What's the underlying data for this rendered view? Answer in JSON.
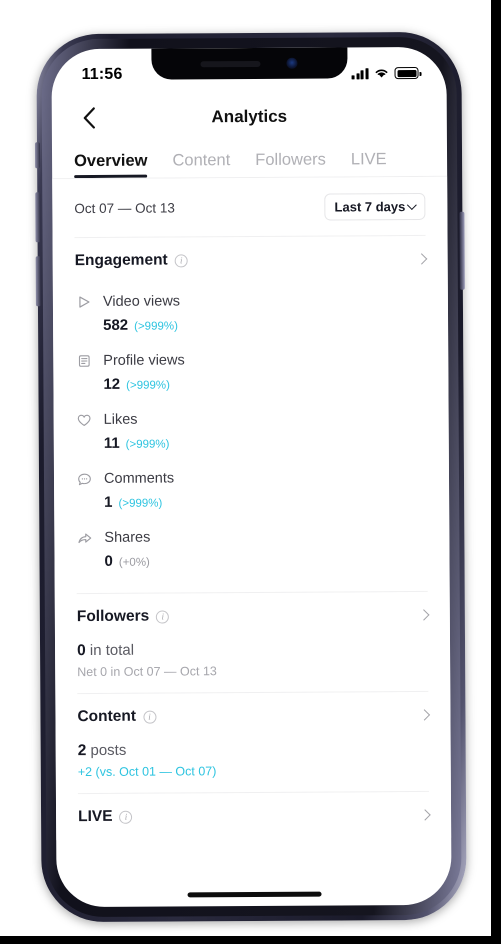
{
  "statusbar": {
    "time": "11:56",
    "signal_icon": "cellular-bars-icon",
    "wifi_icon": "wifi-icon",
    "battery_icon": "battery-icon"
  },
  "navbar": {
    "back_icon": "chevron-left-icon",
    "title": "Analytics"
  },
  "tabs": [
    {
      "label": "Overview",
      "active": true
    },
    {
      "label": "Content",
      "active": false
    },
    {
      "label": "Followers",
      "active": false
    },
    {
      "label": "LIVE",
      "active": false
    }
  ],
  "daterow": {
    "range_text": "Oct 07 — Oct 13",
    "picker_label": "Last 7 days",
    "picker_icon": "chevron-down-icon"
  },
  "engagement": {
    "title": "Engagement",
    "info_icon": "info-icon",
    "chevron_icon": "chevron-right-icon",
    "metrics": [
      {
        "icon": "play-icon",
        "label": "Video views",
        "value": "582",
        "delta": "(>999%)",
        "delta_muted": false
      },
      {
        "icon": "article-icon",
        "label": "Profile views",
        "value": "12",
        "delta": "(>999%)",
        "delta_muted": false
      },
      {
        "icon": "heart-icon",
        "label": "Likes",
        "value": "11",
        "delta": "(>999%)",
        "delta_muted": false
      },
      {
        "icon": "comment-icon",
        "label": "Comments",
        "value": "1",
        "delta": "(>999%)",
        "delta_muted": false
      },
      {
        "icon": "share-icon",
        "label": "Shares",
        "value": "0",
        "delta": "(+0%)",
        "delta_muted": true
      }
    ]
  },
  "followers": {
    "title": "Followers",
    "info_icon": "info-icon",
    "chevron_icon": "chevron-right-icon",
    "value": "0",
    "value_suffix": " in total",
    "sub": "Net 0 in Oct 07 — Oct 13"
  },
  "content": {
    "title": "Content",
    "info_icon": "info-icon",
    "chevron_icon": "chevron-right-icon",
    "value": "2",
    "value_suffix": " posts",
    "sub": "+2 (vs. Oct 01 — Oct 07)"
  },
  "live": {
    "title": "LIVE",
    "info_icon": "info-icon",
    "chevron_icon": "chevron-right-icon"
  },
  "colors": {
    "accent_cyan": "#2ec4e0",
    "text_primary": "#161823",
    "text_muted": "#a6a6ac"
  }
}
